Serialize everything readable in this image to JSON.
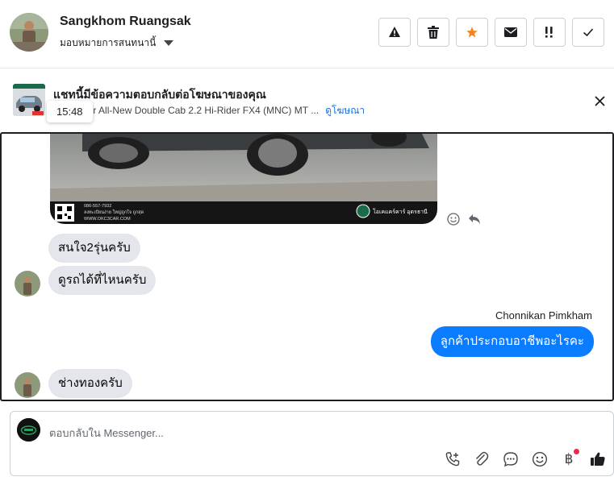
{
  "header": {
    "contact_name": "Sangkhom Ruangsak",
    "assign_label": "มอบหมายการสนทนานี้",
    "actions": [
      "warning-icon",
      "trash-icon",
      "star-icon",
      "mail-icon",
      "urgent-icon",
      "check-icon"
    ],
    "star_color": "#f5831f"
  },
  "banner": {
    "title": "แชทนี้มีข้อความตอบกลับต่อโฆษณาของคุณ",
    "ad_text": "rd Ranger All-New Double Cab 2.2 Hi-Rider FX4 (MNC) MT ...",
    "link": "ดูโฆษณา",
    "tooltip_time": "15:48"
  },
  "ad_image": {
    "phone": "086-557-7932",
    "line2": "ลงทะเบียนง่าย ใหญ่ถูกใจ ถูกสุด",
    "site": "WWW.OKC3CAR.COM",
    "brand": "โอเคแคร์คาร์ อุดรธานี"
  },
  "messages": {
    "in1": "สนใจ2รุ่นครับ",
    "in2": "ดูรถได้ที่ไหนครับ",
    "out_sender": "Chonnikan Pimkham",
    "out1": "ลูกค้าประกอบอาชีพอะไรคะ",
    "in3": "ช่างทองครับ"
  },
  "composer": {
    "placeholder": "ตอบกลับใน Messenger...",
    "tools": [
      "call-add-icon",
      "attach-icon",
      "saved-reply-icon",
      "emoji-icon",
      "baht-payment-icon",
      "thumbs-up-icon"
    ],
    "baht_symbol": "฿",
    "accent": "#0a7cff"
  }
}
